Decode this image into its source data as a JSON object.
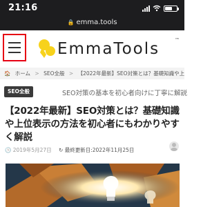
{
  "status_bar": {
    "time": "21:16"
  },
  "browser": {
    "url": "emma.tools"
  },
  "header": {
    "logo_text": "EmmaTools",
    "logo_tm": "™"
  },
  "breadcrumb": {
    "items": [
      "ホーム",
      "SEO全般",
      "【2022年最新】SEO対策とは？基礎知識や上位表示"
    ],
    "separator": ">"
  },
  "article": {
    "category": "SEO全般",
    "subtitle": "SEO対策の基本を初心者向けに丁寧に解説",
    "title": "【2022年最新】SEO対策とは？基礎知識や上位表示の方法を初心者にもわかりやすく解説",
    "published": "2019年5月27日",
    "updated_prefix": "最終更新日:",
    "updated": "2022年11月25日"
  },
  "colors": {
    "accent_red": "#e60012",
    "logo_yellow": "#f7d21c",
    "status_bar": "#1d1d1f"
  }
}
